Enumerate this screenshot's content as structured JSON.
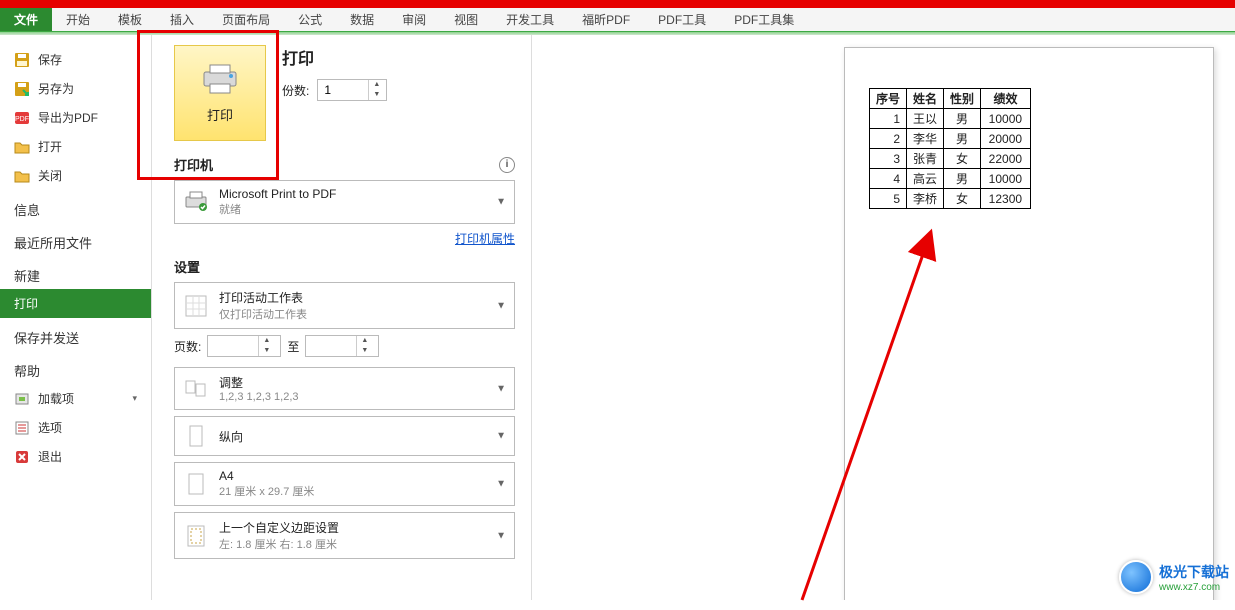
{
  "ribbon": {
    "tabs": [
      "文件",
      "开始",
      "模板",
      "插入",
      "页面布局",
      "公式",
      "数据",
      "审阅",
      "视图",
      "开发工具",
      "福昕PDF",
      "PDF工具",
      "PDF工具集"
    ]
  },
  "sidebar": {
    "save": "保存",
    "save_as": "另存为",
    "export_pdf": "导出为PDF",
    "open": "打开",
    "close": "关闭",
    "info": "信息",
    "recent": "最近所用文件",
    "new": "新建",
    "print": "打印",
    "save_send": "保存并发送",
    "help": "帮助",
    "addins": "加载项",
    "options": "选项",
    "exit": "退出"
  },
  "print": {
    "title": "打印",
    "button": "打印",
    "copies_label": "份数:",
    "copies_value": "1",
    "printer_label": "打印机",
    "printer_name": "Microsoft Print to PDF",
    "printer_status": "就绪",
    "printer_props": "打印机属性",
    "settings_label": "设置",
    "scope_main": "打印活动工作表",
    "scope_sub": "仅打印活动工作表",
    "pages_label": "页数:",
    "pages_to": "至",
    "collate_main": "调整",
    "collate_sub": "1,2,3   1,2,3   1,2,3",
    "orient_main": "纵向",
    "paper_main": "A4",
    "paper_sub": "21 厘米 x 29.7 厘米",
    "margins_main": "上一个自定义边距设置",
    "margins_sub": "左: 1.8 厘米   右: 1.8 厘米"
  },
  "preview": {
    "headers": [
      "序号",
      "姓名",
      "性别",
      "绩效"
    ],
    "rows": [
      {
        "id": "1",
        "name": "王以",
        "sex": "男",
        "score": "10000"
      },
      {
        "id": "2",
        "name": "李华",
        "sex": "男",
        "score": "20000"
      },
      {
        "id": "3",
        "name": "张青",
        "sex": "女",
        "score": "22000"
      },
      {
        "id": "4",
        "name": "高云",
        "sex": "男",
        "score": "10000"
      },
      {
        "id": "5",
        "name": "李桥",
        "sex": "女",
        "score": "12300"
      }
    ]
  },
  "watermark": {
    "line1": "极光下载站",
    "line2": "www.xz7.com"
  }
}
